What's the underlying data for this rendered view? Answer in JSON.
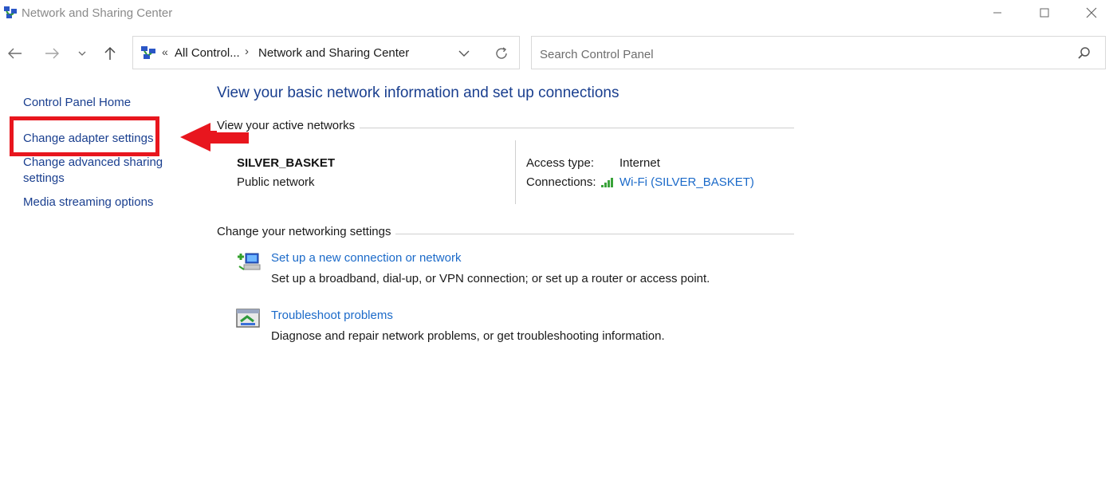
{
  "window": {
    "title": "Network and Sharing Center"
  },
  "address": {
    "overflow": "«",
    "crumbs": [
      "All Control...",
      "Network and Sharing Center"
    ],
    "separator": "›"
  },
  "search": {
    "placeholder": "Search Control Panel"
  },
  "sidebar": {
    "items": [
      {
        "label": "Control Panel Home"
      },
      {
        "label": "Change adapter settings"
      },
      {
        "label": "Change advanced sharing settings"
      },
      {
        "label": "Media streaming options"
      }
    ]
  },
  "main": {
    "heading": "View your basic network information and set up connections",
    "active_section": "View your active networks",
    "network": {
      "name": "SILVER_BASKET",
      "type": "Public network",
      "access_label": "Access type:",
      "access_value": "Internet",
      "connections_label": "Connections:",
      "connection_link": "Wi-Fi (SILVER_BASKET)"
    },
    "settings_section": "Change your networking settings",
    "tasks": [
      {
        "icon": "network-setup-icon",
        "title": "Set up a new connection or network",
        "description": "Set up a broadband, dial-up, or VPN connection; or set up a router or access point."
      },
      {
        "icon": "troubleshoot-icon",
        "title": "Troubleshoot problems",
        "description": "Diagnose and repair network problems, or get troubleshooting information."
      }
    ]
  },
  "colors": {
    "link": "#1b6ac9",
    "heading": "#1a3f8f",
    "annotation": "#e8161e"
  }
}
